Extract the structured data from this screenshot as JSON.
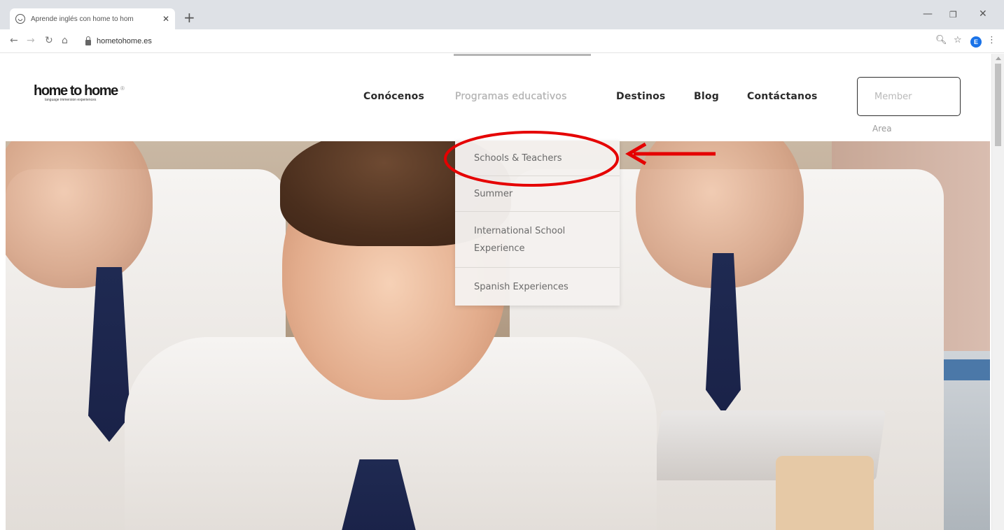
{
  "browser": {
    "tab_title": "Aprende inglés con home to hom",
    "tab_close": "✕",
    "new_tab": "+",
    "url": "hometohome.es",
    "window_controls": {
      "minimize": "—",
      "maximize": "❐",
      "close": "✕"
    },
    "nav": {
      "back": "←",
      "forward": "→",
      "reload": "↻",
      "home": "⌂"
    },
    "right_icons": {
      "zoom": "🔍︎",
      "bookmark": "☆",
      "profile": "E",
      "menu": "⋮"
    },
    "profile_color": "#1a73e8"
  },
  "site": {
    "logo": {
      "text": "home to home",
      "reg_mark": "®",
      "tagline": "language immersion experiences"
    },
    "nav": [
      {
        "label": "Conócenos",
        "active": false
      },
      {
        "label": "Programas educativos",
        "active": true
      },
      {
        "label": "Destinos",
        "active": false
      },
      {
        "label": "Blog",
        "active": false
      },
      {
        "label": "Contáctanos",
        "active": false
      }
    ],
    "member": {
      "button_label": "Member",
      "sub_label": "Area"
    },
    "dropdown": [
      {
        "label": "Schools & Teachers",
        "highlighted": true
      },
      {
        "label": "Summer"
      },
      {
        "label": "International School Experience"
      },
      {
        "label": "Spanish Experiences"
      }
    ]
  },
  "annotation": {
    "color": "#e50000",
    "shape": "circle-and-arrow",
    "target": "Schools & Teachers"
  }
}
